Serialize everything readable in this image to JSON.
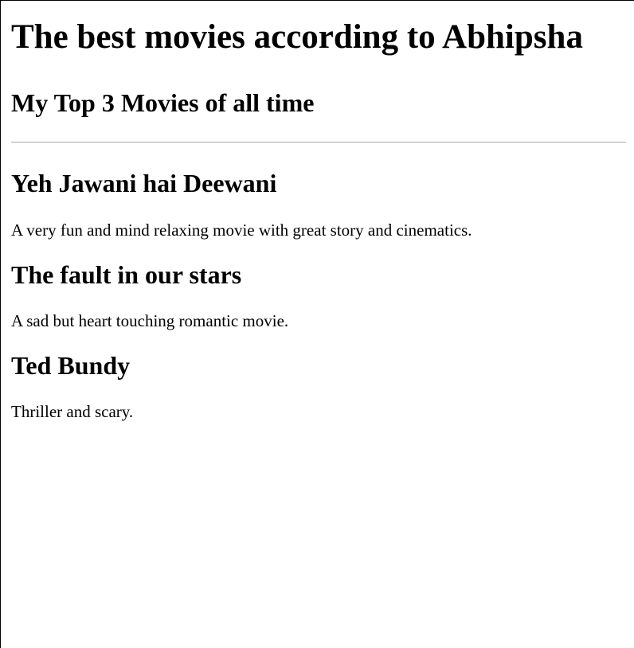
{
  "page": {
    "title": "The best movies according to Abhipsha",
    "subtitle": "My Top 3 Movies of all time"
  },
  "movies": [
    {
      "title": "Yeh Jawani hai Deewani",
      "description": "A very fun and mind relaxing movie with great story and cinematics."
    },
    {
      "title": "The fault in our stars",
      "description": "A sad but heart touching romantic movie."
    },
    {
      "title": "Ted Bundy",
      "description": "Thriller and scary."
    }
  ],
  "colors": {
    "background": "#ffffff",
    "text": "#000000",
    "divider": "#a9a9a9",
    "border": "#000000"
  }
}
